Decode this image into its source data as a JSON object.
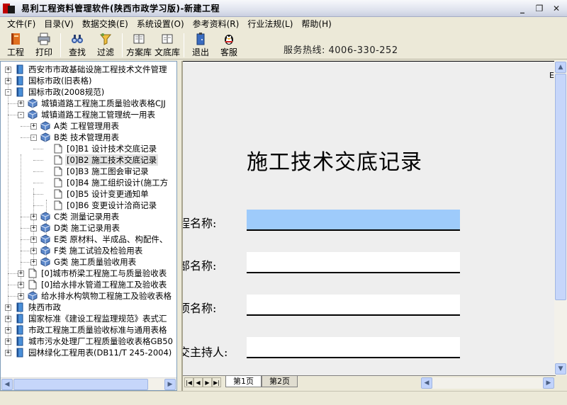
{
  "window": {
    "title": "易利工程资料管理软件(陕西市政学习版)-新建工程",
    "controls": {
      "minimize": "_",
      "restore": "❐",
      "close": "✕"
    }
  },
  "menu": [
    "文件(F)",
    "目录(V)",
    "数据交换(E)",
    "系统设置(O)",
    "参考资料(R)",
    "行业法规(L)",
    "帮助(H)"
  ],
  "toolbar": {
    "buttons": [
      {
        "label": "工程",
        "icon": "project-book-icon"
      },
      {
        "label": "打印",
        "icon": "printer-icon"
      },
      {
        "label": "查找",
        "icon": "binoculars-icon"
      },
      {
        "label": "过滤",
        "icon": "filter-funnel-icon"
      },
      {
        "label": "方案库",
        "icon": "solution-library-icon"
      },
      {
        "label": "文底库",
        "icon": "document-library-icon"
      },
      {
        "label": "退出",
        "icon": "exit-door-icon"
      },
      {
        "label": "客服",
        "icon": "customer-service-penguin-icon"
      }
    ],
    "hotline": "服务热线: 4006-330-252"
  },
  "tree": [
    {
      "text": "西安市市政基础设施工程技术文件管理",
      "level": 0,
      "box": "+",
      "icon": "book"
    },
    {
      "text": "国标市政(旧表格)",
      "level": 0,
      "box": "+",
      "icon": "book"
    },
    {
      "text": "国标市政(2008规范)",
      "level": 0,
      "box": "-",
      "icon": "book"
    },
    {
      "text": "城镇道路工程施工质量验收表格CJJ",
      "level": 1,
      "box": "+",
      "icon": "cube"
    },
    {
      "text": "城镇道路工程施工管理统一用表",
      "level": 1,
      "box": "-",
      "icon": "cube"
    },
    {
      "text": "A类 工程管理用表",
      "level": 2,
      "box": "+",
      "icon": "cube"
    },
    {
      "text": "B类 技术管理用表",
      "level": 2,
      "box": "-",
      "icon": "cube"
    },
    {
      "text": "[0]B1 设计技术交底记录",
      "level": 3,
      "box": "",
      "icon": "page"
    },
    {
      "text": "[0]B2 施工技术交底记录",
      "level": 3,
      "box": "",
      "icon": "page",
      "selected": true
    },
    {
      "text": "[0]B3 施工图会审记录",
      "level": 3,
      "box": "",
      "icon": "page"
    },
    {
      "text": "[0]B4 施工组织设计(施工方",
      "level": 3,
      "box": "",
      "icon": "page"
    },
    {
      "text": "[0]B5 设计变更通知单",
      "level": 3,
      "box": "",
      "icon": "page"
    },
    {
      "text": "[0]B6 变更设计洽商记录",
      "level": 3,
      "box": "",
      "icon": "page"
    },
    {
      "text": "C类 测量记录用表",
      "level": 2,
      "box": "+",
      "icon": "cube"
    },
    {
      "text": "D类 施工记录用表",
      "level": 2,
      "box": "+",
      "icon": "cube"
    },
    {
      "text": "E类 原材料、半成品、构配件、",
      "level": 2,
      "box": "+",
      "icon": "cube"
    },
    {
      "text": "F类 施工试验及检验用表",
      "level": 2,
      "box": "+",
      "icon": "cube"
    },
    {
      "text": "G类 施工质量验收用表",
      "level": 2,
      "box": "+",
      "icon": "cube"
    },
    {
      "text": "[0]城市桥梁工程施工与质量验收表",
      "level": 1,
      "box": "+",
      "icon": "page"
    },
    {
      "text": "[0]给水排水管道工程施工及验收表",
      "level": 1,
      "box": "+",
      "icon": "page"
    },
    {
      "text": "给水排水构筑物工程施工及验收表格",
      "level": 1,
      "box": "+",
      "icon": "cube"
    },
    {
      "text": "陕西市政",
      "level": 0,
      "box": "+",
      "icon": "book"
    },
    {
      "text": "国家标准《建设工程监理规范》表式汇",
      "level": 0,
      "box": "+",
      "icon": "book"
    },
    {
      "text": "市政工程施工质量验收标准与通用表格",
      "level": 0,
      "box": "+",
      "icon": "book"
    },
    {
      "text": "城市污水处理厂工程质量验收表格GB50",
      "level": 0,
      "box": "+",
      "icon": "book"
    },
    {
      "text": "园林绿化工程用表(DB11/T 245-2004)",
      "level": 0,
      "box": "+",
      "icon": "book"
    }
  ],
  "document": {
    "title": "施工技术交底记录",
    "corner_mark": "E",
    "fields": [
      {
        "label": "程名称:",
        "value": "",
        "active": true
      },
      {
        "label": "部名称:",
        "value": ""
      },
      {
        "label": "项名称:",
        "value": ""
      },
      {
        "label": "交主持人:",
        "value": ""
      }
    ]
  },
  "sheets": [
    "第1页",
    "第2页"
  ],
  "colors": {
    "tree_book": "#4a8fd8",
    "tree_cube": "#5a86c9",
    "active_field": "#9ecbfb"
  }
}
